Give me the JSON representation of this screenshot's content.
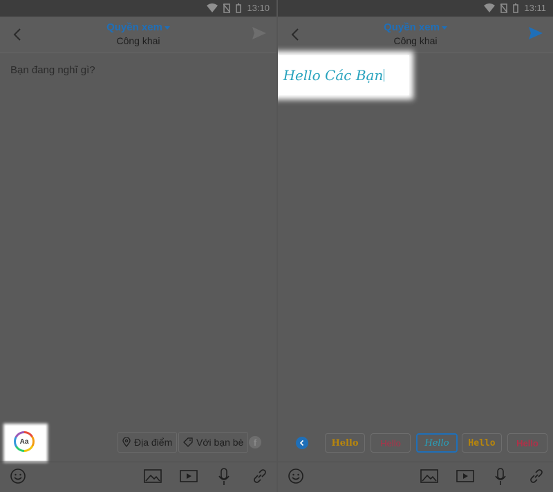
{
  "left": {
    "status_time": "13:10",
    "header": {
      "title": "Quyền xem",
      "subtitle": "Công khai"
    },
    "composer_placeholder": "Bạn đang nghĩ gì?",
    "font_button_label": "Aa",
    "chips": {
      "location": "Địa điểm",
      "friends": "Với bạn bè"
    },
    "fb_letter": "f"
  },
  "right": {
    "status_time": "13:11",
    "header": {
      "title": "Quyền xem",
      "subtitle": "Công khai"
    },
    "composer_text": "Hello Các Bạn",
    "fonts": [
      "Hello",
      "Hello",
      "Hello",
      "Hello",
      "Hello"
    ]
  },
  "colors": {
    "accent": "#1f6fb8",
    "hello_text": "#26a2bd"
  },
  "icons": [
    "wifi-icon",
    "no-sim-icon",
    "battery-icon",
    "back-icon",
    "send-icon",
    "pin-icon",
    "tag-icon",
    "emoji-icon",
    "image-icon",
    "video-icon",
    "mic-icon",
    "link-icon"
  ]
}
